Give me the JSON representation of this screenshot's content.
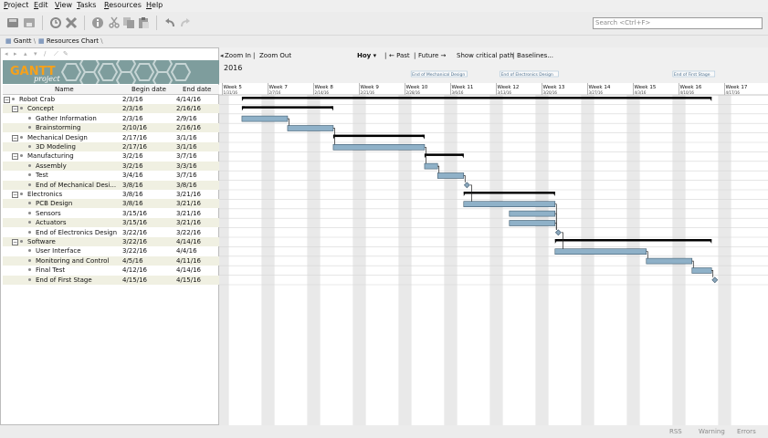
{
  "menu": {
    "items": [
      "Project",
      "Edit",
      "View",
      "Tasks",
      "Resources",
      "Help"
    ]
  },
  "toolbar": {
    "buttons": [
      "new-icon",
      "save-icon",
      "history-icon",
      "delete-icon",
      "info-icon",
      "cut-icon",
      "copy-icon",
      "paste-icon",
      "undo-icon",
      "redo-icon"
    ],
    "search_placeholder": "Search <Ctrl+F>"
  },
  "tabs": [
    {
      "label": "Gantt",
      "active": true
    },
    {
      "label": "Resources Chart",
      "active": false
    }
  ],
  "branding": {
    "logo": "GANTT project"
  },
  "columns": {
    "name": "Name",
    "begin": "Begin date",
    "end": "End date"
  },
  "tasks": [
    {
      "name": "Robot Crab",
      "begin": "2/3/16",
      "end": "4/14/16",
      "level": 0,
      "group": true
    },
    {
      "name": "Concept",
      "begin": "2/3/16",
      "end": "2/16/16",
      "level": 1,
      "group": true
    },
    {
      "name": "Gather Information",
      "begin": "2/3/16",
      "end": "2/9/16",
      "level": 2,
      "group": false
    },
    {
      "name": "Brainstorming",
      "begin": "2/10/16",
      "end": "2/16/16",
      "level": 2,
      "group": false
    },
    {
      "name": "Mechanical Design",
      "begin": "2/17/16",
      "end": "3/1/16",
      "level": 1,
      "group": true
    },
    {
      "name": "3D Modeling",
      "begin": "2/17/16",
      "end": "3/1/16",
      "level": 2,
      "group": false
    },
    {
      "name": "Manufacturing",
      "begin": "3/2/16",
      "end": "3/7/16",
      "level": 1,
      "group": true
    },
    {
      "name": "Assembly",
      "begin": "3/2/16",
      "end": "3/3/16",
      "level": 2,
      "group": false
    },
    {
      "name": "Test",
      "begin": "3/4/16",
      "end": "3/7/16",
      "level": 2,
      "group": false
    },
    {
      "name": "End of Mechanical Desi...",
      "begin": "3/8/16",
      "end": "3/8/16",
      "level": 2,
      "group": false
    },
    {
      "name": "Electronics",
      "begin": "3/8/16",
      "end": "3/21/16",
      "level": 1,
      "group": true
    },
    {
      "name": "PCB Design",
      "begin": "3/8/16",
      "end": "3/21/16",
      "level": 2,
      "group": false
    },
    {
      "name": "Sensors",
      "begin": "3/15/16",
      "end": "3/21/16",
      "level": 2,
      "group": false
    },
    {
      "name": "Actuators",
      "begin": "3/15/16",
      "end": "3/21/16",
      "level": 2,
      "group": false
    },
    {
      "name": "End of Electronics Design",
      "begin": "3/22/16",
      "end": "3/22/16",
      "level": 2,
      "group": false
    },
    {
      "name": "Software",
      "begin": "3/22/16",
      "end": "4/14/16",
      "level": 1,
      "group": true
    },
    {
      "name": "User Interface",
      "begin": "3/22/16",
      "end": "4/4/16",
      "level": 2,
      "group": false
    },
    {
      "name": "Monitoring and Control",
      "begin": "4/5/16",
      "end": "4/11/16",
      "level": 2,
      "group": false
    },
    {
      "name": "Final Test",
      "begin": "4/12/16",
      "end": "4/14/16",
      "level": 2,
      "group": false
    },
    {
      "name": "End of First Stage",
      "begin": "4/15/16",
      "end": "4/15/16",
      "level": 2,
      "group": false
    }
  ],
  "gantt_toolbar": {
    "zoom_in": "Zoom In",
    "zoom_out": "Zoom Out",
    "sep": "|",
    "today": "Hoy",
    "past": "← Past",
    "future": "Future →",
    "critical": "Show critical path",
    "baselines": "Baselines..."
  },
  "year": "2016",
  "milestones": [
    "End of Mechanical Design",
    "End of Electronics Design",
    "End of First Stage"
  ],
  "weeks": [
    {
      "label": "Week 5",
      "date": "1/31/16"
    },
    {
      "label": "Week 7",
      "date": "2/7/16"
    },
    {
      "label": "Week 8",
      "date": "2/14/16"
    },
    {
      "label": "Week 9",
      "date": "2/21/16"
    },
    {
      "label": "Week 10",
      "date": "2/28/16"
    },
    {
      "label": "Week 11",
      "date": "3/6/16"
    },
    {
      "label": "Week 12",
      "date": "3/13/16"
    },
    {
      "label": "Week 13",
      "date": "3/20/16"
    },
    {
      "label": "Week 14",
      "date": "3/27/16"
    },
    {
      "label": "Week 15",
      "date": "4/3/16"
    },
    {
      "label": "Week 16",
      "date": "4/10/16"
    },
    {
      "label": "Week 17",
      "date": "4/17/16"
    }
  ],
  "status": [
    "RSS",
    "Warning",
    "Errors"
  ],
  "colors": {
    "bar": "#8fb1c8",
    "bar_border": "#3f5a6e",
    "summary": "#000000",
    "weekend": "#e9e9e9",
    "banner": "#7e9d9d"
  }
}
